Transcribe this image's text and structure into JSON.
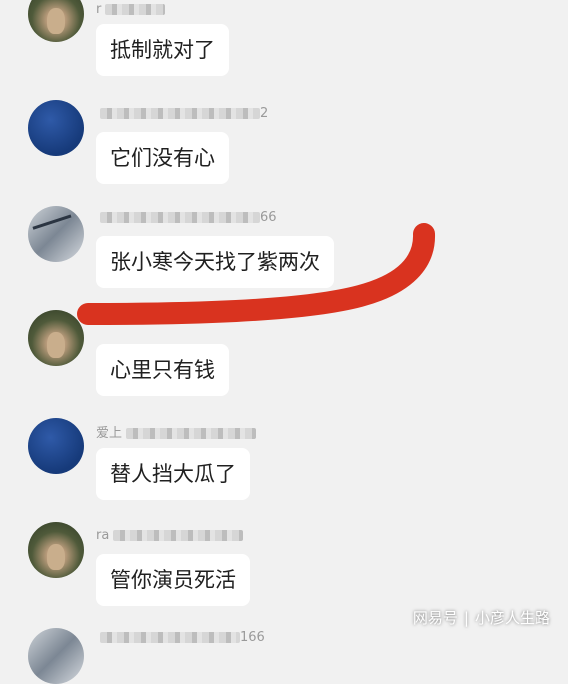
{
  "messages": [
    {
      "name": "r",
      "text": "抵制就对了"
    },
    {
      "name": "2",
      "text": "它们没有心"
    },
    {
      "name": "66",
      "text": "张小寒今天找了紫两次"
    },
    {
      "name": "",
      "text": "心里只有钱"
    },
    {
      "name": "爱上",
      "text": "替人挡大瓜了"
    },
    {
      "name": "ra",
      "text": "管你演员死活"
    },
    {
      "name": "166",
      "text": ""
    }
  ],
  "watermark": {
    "left": "网易号",
    "right": "小彦人生路"
  },
  "colors": {
    "scribble": "#d9331f",
    "bubble": "#ffffff",
    "background": "#f1f1f1"
  }
}
